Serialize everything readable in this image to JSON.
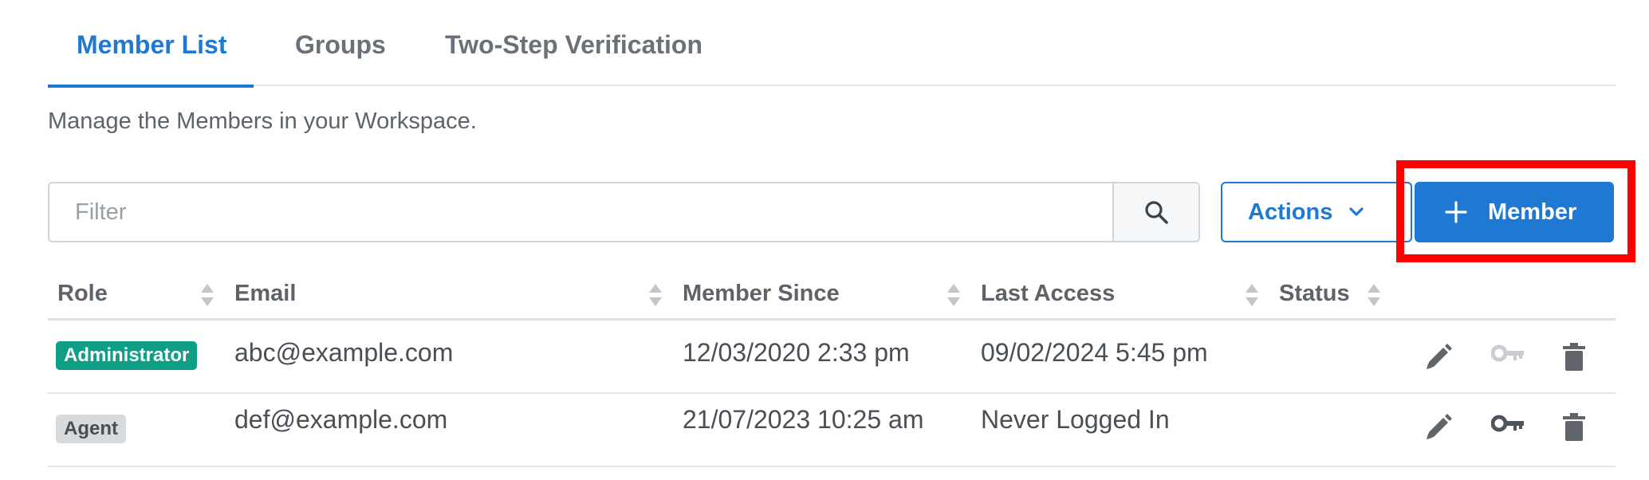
{
  "tabs": [
    {
      "label": "Member List",
      "active": true
    },
    {
      "label": "Groups",
      "active": false
    },
    {
      "label": "Two-Step Verification",
      "active": false
    }
  ],
  "description": "Manage the Members in your Workspace.",
  "filter": {
    "placeholder": "Filter",
    "value": ""
  },
  "toolbar": {
    "actions_label": "Actions",
    "add_member_label": "Member"
  },
  "table": {
    "headers": [
      "Role",
      "Email",
      "Member Since",
      "Last Access",
      "Status"
    ],
    "rows": [
      {
        "role": "Administrator",
        "email": "abc@example.com",
        "member_since": "12/03/2020 2:33 pm",
        "last_access": "09/02/2024 5:45 pm",
        "status": "",
        "key_enabled": false
      },
      {
        "role": "Agent",
        "email": "def@example.com",
        "member_since": "21/07/2023 10:25 am",
        "last_access": "Never Logged In",
        "status": "",
        "key_enabled": true
      }
    ]
  },
  "colors": {
    "accent": "#1f78d1",
    "admin_badge": "#0e9f86",
    "agent_badge": "#d8dbde",
    "highlight": "#ff0000"
  },
  "icons": {
    "search": "search-icon",
    "chevron": "chevron-down-icon",
    "plus": "plus-icon",
    "edit": "pencil-icon",
    "key": "key-icon",
    "delete": "trash-icon",
    "sort": "sort-icon"
  }
}
